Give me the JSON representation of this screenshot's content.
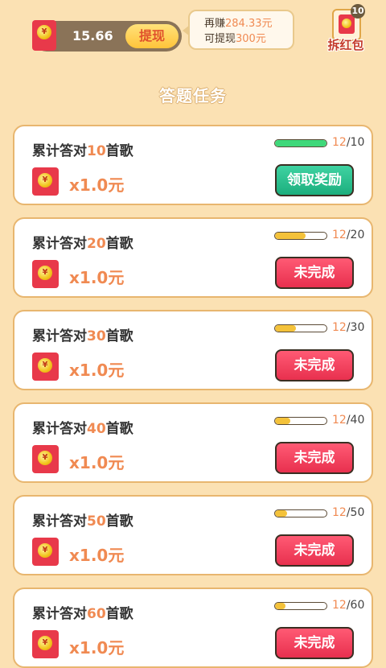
{
  "wallet": {
    "amount": "15.66",
    "withdraw_label": "提现",
    "coin_symbol": "¥"
  },
  "bubble": {
    "line1_prefix": "再赚",
    "line1_value": "284.33元",
    "line2_prefix": "可提现",
    "line2_value": "300元"
  },
  "red_packet": {
    "label": "拆红包",
    "count": "10"
  },
  "section_title": "答题任务",
  "colors": {
    "accent": "#f08a52",
    "claim_button": "#1cae7d",
    "pending_button": "#e8304e",
    "bar_done": "#3fd87a",
    "bar_partial": "#f4c23a",
    "background": "#fbe1b3"
  },
  "tasks": [
    {
      "title_prefix": "累计答对",
      "target": "10",
      "title_suffix": "首歌",
      "reward": "x1.0元",
      "current": "12",
      "total": "/10",
      "progress": 1.0,
      "button": "领取奖励",
      "status": "claim"
    },
    {
      "title_prefix": "累计答对",
      "target": "20",
      "title_suffix": "首歌",
      "reward": "x1.0元",
      "current": "12",
      "total": "/20",
      "progress": 0.6,
      "button": "未完成",
      "status": "pending"
    },
    {
      "title_prefix": "累计答对",
      "target": "30",
      "title_suffix": "首歌",
      "reward": "x1.0元",
      "current": "12",
      "total": "/30",
      "progress": 0.4,
      "button": "未完成",
      "status": "pending"
    },
    {
      "title_prefix": "累计答对",
      "target": "40",
      "title_suffix": "首歌",
      "reward": "x1.0元",
      "current": "12",
      "total": "/40",
      "progress": 0.3,
      "button": "未完成",
      "status": "pending"
    },
    {
      "title_prefix": "累计答对",
      "target": "50",
      "title_suffix": "首歌",
      "reward": "x1.0元",
      "current": "12",
      "total": "/50",
      "progress": 0.24,
      "button": "未完成",
      "status": "pending"
    },
    {
      "title_prefix": "累计答对",
      "target": "60",
      "title_suffix": "首歌",
      "reward": "x1.0元",
      "current": "12",
      "total": "/60",
      "progress": 0.2,
      "button": "未完成",
      "status": "pending"
    }
  ]
}
